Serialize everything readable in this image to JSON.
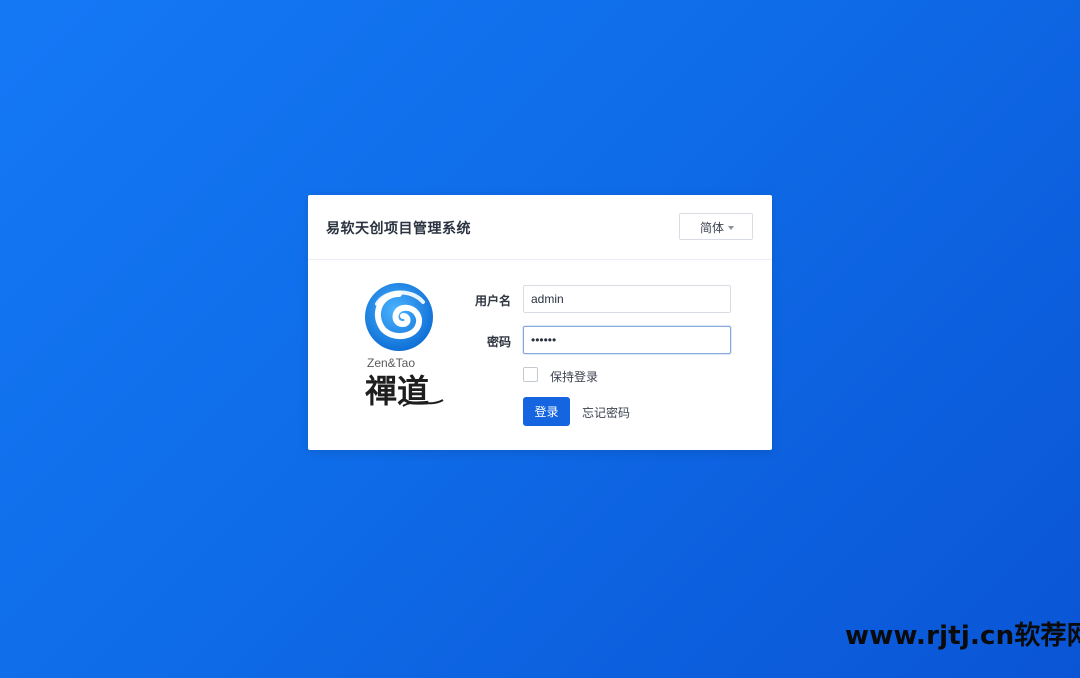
{
  "header": {
    "title": "易软天创项目管理系统",
    "language": "简体"
  },
  "logo": {
    "caption": "Zen&Tao",
    "chinese_text": "禪道",
    "icon": "zentao-swirl-logo"
  },
  "form": {
    "username_label": "用户名",
    "username_value": "admin",
    "password_label": "密码",
    "password_value": "••••••",
    "remember_label": "保持登录",
    "remember_checked": false,
    "login_button": "登录",
    "forgot_link": "忘记密码"
  },
  "watermark": {
    "text": "www.rjtj.cn软荐网"
  },
  "colors": {
    "background": "#1478f5",
    "primary_button": "#1565e0",
    "logo_blue": "#1a8ef0"
  }
}
